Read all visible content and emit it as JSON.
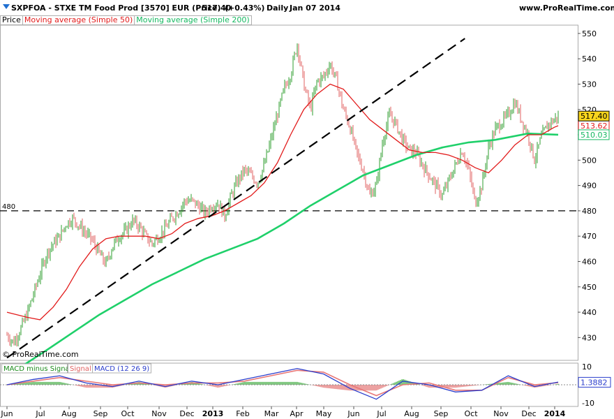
{
  "header": {
    "title": "SXPFOA - STXE TM Food Prod [3570] EUR (Price)",
    "last": "517.40",
    "change": "(+0.43%)",
    "period": "Daily",
    "date": "Jan 07 2014",
    "brand": "www.ProRealTime.com",
    "watermark": "© ProRealTime.com"
  },
  "legend": {
    "price": "Price",
    "ma50": "Moving average (Simple 50)",
    "ma200": "Moving average (Simple 200)"
  },
  "colors": {
    "bullish": "#2e9c2e",
    "bearish": "#e06262",
    "ma50": "#e21b1b",
    "ma200": "#1fd06a",
    "macd": "#2a3dcc",
    "signal": "#e87777",
    "histo": "#2ea32e",
    "trend": "#000000"
  },
  "chart_data": {
    "type": "ohlc",
    "period": "Daily",
    "ylim": [
      421,
      553
    ],
    "y_ticks": [
      430,
      440,
      450,
      460,
      470,
      480,
      490,
      500,
      510,
      520,
      530,
      540,
      550
    ],
    "x_ticks": [
      "Jun",
      "Jul",
      "Aug",
      "Sep",
      "Oct",
      "Nov",
      "Dec",
      "2013",
      "Feb",
      "Mar",
      "Apr",
      "May",
      "Jun",
      "Jul",
      "Aug",
      "Sep",
      "Oct",
      "Nov",
      "Dec",
      "2014"
    ],
    "last_price": 517.4,
    "price_labels": {
      "last": "517.40",
      "ma50": "513.62",
      "ma200": "510.03"
    },
    "price_path": [
      {
        "d": "2012-06-01",
        "v": 431
      },
      {
        "d": "2012-06-08",
        "v": 428
      },
      {
        "d": "2012-06-15",
        "v": 433
      },
      {
        "d": "2012-06-22",
        "v": 439
      },
      {
        "d": "2012-06-29",
        "v": 447
      },
      {
        "d": "2012-07-06",
        "v": 455
      },
      {
        "d": "2012-07-13",
        "v": 463
      },
      {
        "d": "2012-07-20",
        "v": 467
      },
      {
        "d": "2012-07-27",
        "v": 470
      },
      {
        "d": "2012-08-03",
        "v": 475
      },
      {
        "d": "2012-08-10",
        "v": 477
      },
      {
        "d": "2012-08-17",
        "v": 474
      },
      {
        "d": "2012-08-24",
        "v": 471
      },
      {
        "d": "2012-08-31",
        "v": 468
      },
      {
        "d": "2012-09-07",
        "v": 463
      },
      {
        "d": "2012-09-14",
        "v": 459
      },
      {
        "d": "2012-09-21",
        "v": 466
      },
      {
        "d": "2012-09-28",
        "v": 470
      },
      {
        "d": "2012-10-05",
        "v": 472
      },
      {
        "d": "2012-10-12",
        "v": 476
      },
      {
        "d": "2012-10-19",
        "v": 474
      },
      {
        "d": "2012-10-26",
        "v": 470
      },
      {
        "d": "2012-11-02",
        "v": 467
      },
      {
        "d": "2012-11-09",
        "v": 470
      },
      {
        "d": "2012-11-16",
        "v": 473
      },
      {
        "d": "2012-11-23",
        "v": 477
      },
      {
        "d": "2012-11-30",
        "v": 480
      },
      {
        "d": "2012-12-07",
        "v": 484
      },
      {
        "d": "2012-12-14",
        "v": 484
      },
      {
        "d": "2012-12-21",
        "v": 482
      },
      {
        "d": "2012-12-28",
        "v": 479
      },
      {
        "d": "2013-01-04",
        "v": 482
      },
      {
        "d": "2013-01-11",
        "v": 483
      },
      {
        "d": "2013-01-18",
        "v": 478
      },
      {
        "d": "2013-01-25",
        "v": 486
      },
      {
        "d": "2013-02-01",
        "v": 492
      },
      {
        "d": "2013-02-08",
        "v": 496
      },
      {
        "d": "2013-02-15",
        "v": 494
      },
      {
        "d": "2013-02-22",
        "v": 491
      },
      {
        "d": "2013-03-01",
        "v": 498
      },
      {
        "d": "2013-03-08",
        "v": 508
      },
      {
        "d": "2013-03-15",
        "v": 518
      },
      {
        "d": "2013-03-22",
        "v": 528
      },
      {
        "d": "2013-03-29",
        "v": 534
      },
      {
        "d": "2013-04-05",
        "v": 546
      },
      {
        "d": "2013-04-12",
        "v": 530
      },
      {
        "d": "2013-04-19",
        "v": 520
      },
      {
        "d": "2013-04-26",
        "v": 531
      },
      {
        "d": "2013-05-03",
        "v": 533
      },
      {
        "d": "2013-05-10",
        "v": 538
      },
      {
        "d": "2013-05-17",
        "v": 531
      },
      {
        "d": "2013-05-24",
        "v": 520
      },
      {
        "d": "2013-05-31",
        "v": 513
      },
      {
        "d": "2013-06-07",
        "v": 503
      },
      {
        "d": "2013-06-14",
        "v": 496
      },
      {
        "d": "2013-06-21",
        "v": 486
      },
      {
        "d": "2013-06-28",
        "v": 490
      },
      {
        "d": "2013-07-05",
        "v": 508
      },
      {
        "d": "2013-07-12",
        "v": 518
      },
      {
        "d": "2013-07-19",
        "v": 514
      },
      {
        "d": "2013-07-26",
        "v": 508
      },
      {
        "d": "2013-08-02",
        "v": 504
      },
      {
        "d": "2013-08-09",
        "v": 503
      },
      {
        "d": "2013-08-16",
        "v": 498
      },
      {
        "d": "2013-08-23",
        "v": 494
      },
      {
        "d": "2013-08-30",
        "v": 490
      },
      {
        "d": "2013-09-06",
        "v": 486
      },
      {
        "d": "2013-09-13",
        "v": 492
      },
      {
        "d": "2013-09-20",
        "v": 498
      },
      {
        "d": "2013-09-27",
        "v": 504
      },
      {
        "d": "2013-10-04",
        "v": 496
      },
      {
        "d": "2013-10-11",
        "v": 483
      },
      {
        "d": "2013-10-18",
        "v": 490
      },
      {
        "d": "2013-10-25",
        "v": 505
      },
      {
        "d": "2013-11-01",
        "v": 512
      },
      {
        "d": "2013-11-08",
        "v": 515
      },
      {
        "d": "2013-11-15",
        "v": 518
      },
      {
        "d": "2013-11-22",
        "v": 523
      },
      {
        "d": "2013-11-29",
        "v": 516
      },
      {
        "d": "2013-12-06",
        "v": 510
      },
      {
        "d": "2013-12-13",
        "v": 500
      },
      {
        "d": "2013-12-20",
        "v": 509
      },
      {
        "d": "2013-12-27",
        "v": 514
      },
      {
        "d": "2014-01-03",
        "v": 516
      },
      {
        "d": "2014-01-07",
        "v": 517.4
      }
    ],
    "ma50": [
      {
        "d": "2012-06-01",
        "v": 440
      },
      {
        "d": "2012-06-22",
        "v": 438
      },
      {
        "d": "2012-07-06",
        "v": 437
      },
      {
        "d": "2012-07-20",
        "v": 442
      },
      {
        "d": "2012-08-03",
        "v": 449
      },
      {
        "d": "2012-08-17",
        "v": 458
      },
      {
        "d": "2012-08-31",
        "v": 465
      },
      {
        "d": "2012-09-14",
        "v": 469
      },
      {
        "d": "2012-09-28",
        "v": 470
      },
      {
        "d": "2012-10-12",
        "v": 470
      },
      {
        "d": "2012-10-26",
        "v": 470
      },
      {
        "d": "2012-11-09",
        "v": 469
      },
      {
        "d": "2012-11-23",
        "v": 471
      },
      {
        "d": "2012-12-07",
        "v": 475
      },
      {
        "d": "2012-12-21",
        "v": 477
      },
      {
        "d": "2013-01-04",
        "v": 478
      },
      {
        "d": "2013-01-18",
        "v": 480
      },
      {
        "d": "2013-02-01",
        "v": 483
      },
      {
        "d": "2013-02-15",
        "v": 486
      },
      {
        "d": "2013-03-01",
        "v": 491
      },
      {
        "d": "2013-03-15",
        "v": 499
      },
      {
        "d": "2013-03-29",
        "v": 510
      },
      {
        "d": "2013-04-12",
        "v": 520
      },
      {
        "d": "2013-04-26",
        "v": 526
      },
      {
        "d": "2013-05-10",
        "v": 530
      },
      {
        "d": "2013-05-24",
        "v": 528
      },
      {
        "d": "2013-06-07",
        "v": 522
      },
      {
        "d": "2013-06-21",
        "v": 516
      },
      {
        "d": "2013-07-05",
        "v": 512
      },
      {
        "d": "2013-07-19",
        "v": 508
      },
      {
        "d": "2013-08-02",
        "v": 504
      },
      {
        "d": "2013-08-16",
        "v": 503
      },
      {
        "d": "2013-08-30",
        "v": 503
      },
      {
        "d": "2013-09-13",
        "v": 502
      },
      {
        "d": "2013-09-27",
        "v": 500
      },
      {
        "d": "2013-10-11",
        "v": 497
      },
      {
        "d": "2013-10-25",
        "v": 495
      },
      {
        "d": "2013-11-08",
        "v": 500
      },
      {
        "d": "2013-11-22",
        "v": 506
      },
      {
        "d": "2013-12-06",
        "v": 510
      },
      {
        "d": "2013-12-20",
        "v": 510
      },
      {
        "d": "2014-01-03",
        "v": 513
      },
      {
        "d": "2014-01-07",
        "v": 513.6
      }
    ],
    "ma200": [
      {
        "d": "2012-06-14",
        "v": 418
      },
      {
        "d": "2012-07-13",
        "v": 425
      },
      {
        "d": "2012-08-10",
        "v": 432
      },
      {
        "d": "2012-09-07",
        "v": 439
      },
      {
        "d": "2012-10-05",
        "v": 445
      },
      {
        "d": "2012-11-02",
        "v": 451
      },
      {
        "d": "2012-11-30",
        "v": 456
      },
      {
        "d": "2012-12-28",
        "v": 461
      },
      {
        "d": "2013-01-25",
        "v": 465
      },
      {
        "d": "2013-02-22",
        "v": 469
      },
      {
        "d": "2013-03-22",
        "v": 475
      },
      {
        "d": "2013-04-19",
        "v": 482
      },
      {
        "d": "2013-05-17",
        "v": 488
      },
      {
        "d": "2013-06-14",
        "v": 494
      },
      {
        "d": "2013-07-12",
        "v": 498
      },
      {
        "d": "2013-08-09",
        "v": 502
      },
      {
        "d": "2013-09-06",
        "v": 505
      },
      {
        "d": "2013-10-04",
        "v": 507
      },
      {
        "d": "2013-11-01",
        "v": 508
      },
      {
        "d": "2013-12-06",
        "v": 510.5
      },
      {
        "d": "2014-01-07",
        "v": 510.03
      }
    ],
    "annotations": {
      "horizontal_level": {
        "value": 480,
        "label": "480",
        "style": "dashed"
      },
      "trendline": {
        "from": {
          "d": "2012-06-01",
          "v": 422
        },
        "to": {
          "d": "2013-09-30",
          "v": 548
        },
        "style": "dashed"
      }
    },
    "macd": {
      "legend": [
        "MACD minus Signal",
        "Signal",
        "MACD (12 26 9)"
      ],
      "params": "12 26 9",
      "ylim": [
        -12,
        12
      ],
      "y_ticks": [
        10,
        -10
      ],
      "last_label": "1.3882",
      "macd": [
        {
          "d": "2012-06-01",
          "v": 0
        },
        {
          "d": "2012-06-29",
          "v": 3
        },
        {
          "d": "2012-07-27",
          "v": 5
        },
        {
          "d": "2012-08-24",
          "v": 1
        },
        {
          "d": "2012-09-21",
          "v": -1
        },
        {
          "d": "2012-10-19",
          "v": 2
        },
        {
          "d": "2012-11-16",
          "v": -1
        },
        {
          "d": "2012-12-14",
          "v": 2
        },
        {
          "d": "2013-01-11",
          "v": 0
        },
        {
          "d": "2013-02-08",
          "v": 3
        },
        {
          "d": "2013-03-08",
          "v": 6
        },
        {
          "d": "2013-04-05",
          "v": 9
        },
        {
          "d": "2013-05-03",
          "v": 6
        },
        {
          "d": "2013-05-31",
          "v": -2
        },
        {
          "d": "2013-06-28",
          "v": -8
        },
        {
          "d": "2013-07-26",
          "v": 2
        },
        {
          "d": "2013-08-23",
          "v": 0
        },
        {
          "d": "2013-09-20",
          "v": -4
        },
        {
          "d": "2013-10-18",
          "v": -3
        },
        {
          "d": "2013-11-15",
          "v": 5
        },
        {
          "d": "2013-12-13",
          "v": -1
        },
        {
          "d": "2014-01-07",
          "v": 1.5
        }
      ],
      "signal": [
        {
          "d": "2012-06-01",
          "v": 0
        },
        {
          "d": "2012-06-29",
          "v": 2
        },
        {
          "d": "2012-07-27",
          "v": 4
        },
        {
          "d": "2012-08-24",
          "v": 2
        },
        {
          "d": "2012-09-21",
          "v": 0
        },
        {
          "d": "2012-10-19",
          "v": 1
        },
        {
          "d": "2012-11-16",
          "v": 0
        },
        {
          "d": "2012-12-14",
          "v": 1
        },
        {
          "d": "2013-01-11",
          "v": 1
        },
        {
          "d": "2013-02-08",
          "v": 2
        },
        {
          "d": "2013-03-08",
          "v": 5
        },
        {
          "d": "2013-04-05",
          "v": 8
        },
        {
          "d": "2013-05-03",
          "v": 7
        },
        {
          "d": "2013-05-31",
          "v": 0
        },
        {
          "d": "2013-06-28",
          "v": -6
        },
        {
          "d": "2013-07-26",
          "v": 0
        },
        {
          "d": "2013-08-23",
          "v": 1
        },
        {
          "d": "2013-09-20",
          "v": -3
        },
        {
          "d": "2013-10-18",
          "v": -3
        },
        {
          "d": "2013-11-15",
          "v": 4
        },
        {
          "d": "2013-12-13",
          "v": 0
        },
        {
          "d": "2014-01-07",
          "v": 1.2
        }
      ]
    }
  }
}
